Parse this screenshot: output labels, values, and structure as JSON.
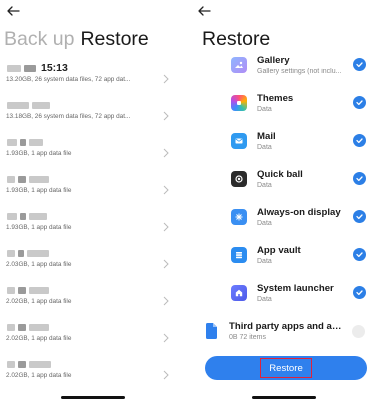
{
  "left_panel": {
    "tabs": {
      "backup": "Back up",
      "restore": "Restore"
    },
    "backups": [
      {
        "time": "15:13",
        "meta": "13.20GB, 26 system data files, 72 app dat..."
      },
      {
        "time": "",
        "meta": "13.18GB, 26 system data files, 72 app dat..."
      },
      {
        "time": "",
        "meta": "1.93GB, 1 app data file"
      },
      {
        "time": "",
        "meta": "1.93GB, 1 app data file"
      },
      {
        "time": "",
        "meta": "1.93GB, 1 app data file"
      },
      {
        "time": "",
        "meta": "2.03GB, 1 app data file"
      },
      {
        "time": "",
        "meta": "2.02GB, 1 app data file"
      },
      {
        "time": "",
        "meta": "2.02GB, 1 app data file"
      },
      {
        "time": "",
        "meta": "2.02GB, 1 app data file"
      }
    ]
  },
  "right_panel": {
    "title": "Restore",
    "items": [
      {
        "label": "Gallery",
        "sub": "Gallery settings (not inclu...",
        "icon": "gallery-icon",
        "color": "#7f8ef0"
      },
      {
        "label": "Themes",
        "sub": "Data",
        "icon": "themes-icon",
        "color": "#e8408a"
      },
      {
        "label": "Mail",
        "sub": "Data",
        "icon": "mail-icon",
        "color": "#2f9af0"
      },
      {
        "label": "Quick ball",
        "sub": "Data",
        "icon": "quick-ball-icon",
        "color": "#2b2b2b"
      },
      {
        "label": "Always-on display",
        "sub": "Data",
        "icon": "always-on-display-icon",
        "color": "#3a8ff2"
      },
      {
        "label": "App vault",
        "sub": "Data",
        "icon": "app-vault-icon",
        "color": "#2b8cf0"
      },
      {
        "label": "System launcher",
        "sub": "Data",
        "icon": "system-launcher-icon",
        "color": "#5a6bef"
      }
    ],
    "third_party": {
      "label": "Third party apps and app...",
      "sub": "0B  72 items"
    },
    "restore_button": "Restore"
  },
  "colors": {
    "accent": "#2f80ed",
    "highlight": "#e0223b"
  }
}
